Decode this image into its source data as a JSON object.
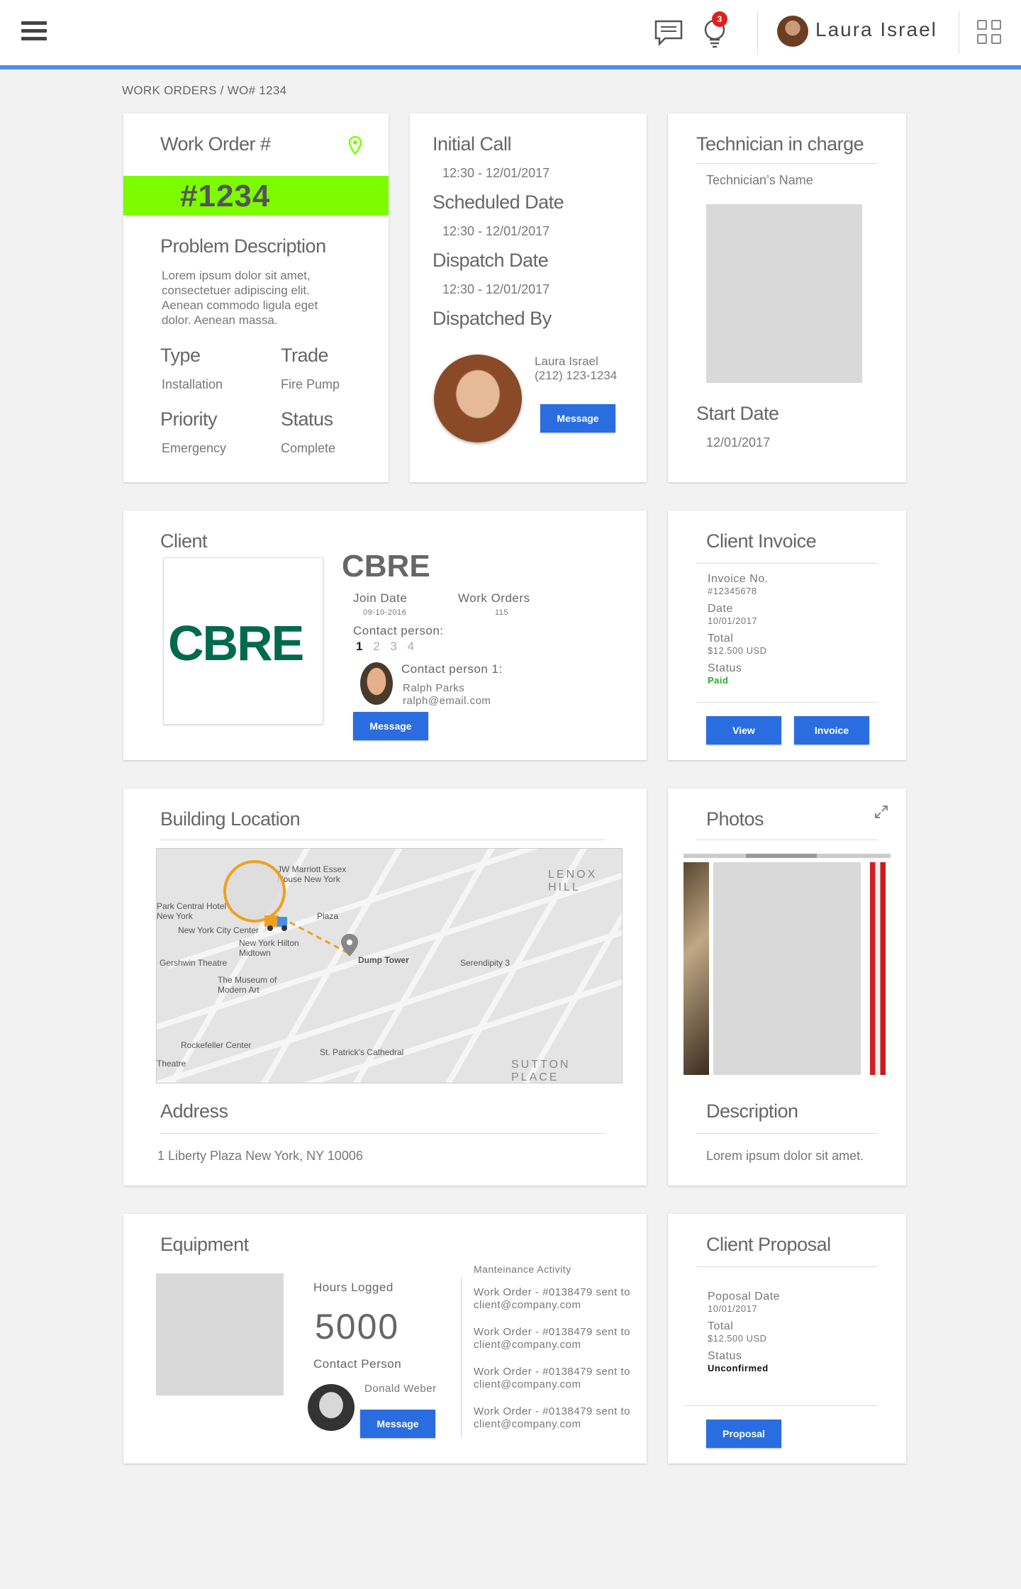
{
  "header": {
    "user_name": "Laura Israel",
    "notification_count": "3"
  },
  "breadcrumb": "WORK ORDERS / WO# 1234",
  "work_order": {
    "title": "Work Order #",
    "number": "#1234",
    "problem_title": "Problem Description",
    "problem_text": "Lorem ipsum dolor sit amet, consectetuer adipiscing elit. Aenean commodo ligula eget dolor. Aenean massa.",
    "type_label": "Type",
    "type_value": "Installation",
    "trade_label": "Trade",
    "trade_value": "Fire Pump",
    "priority_label": "Priority",
    "priority_value": "Emergency",
    "status_label": "Status",
    "status_value": "Complete",
    "accent": "#7dfc00"
  },
  "dates": {
    "initial_call_label": "Initial Call",
    "initial_call_value": "12:30 - 12/01/2017",
    "scheduled_label": "Scheduled Date",
    "scheduled_value": "12:30 - 12/01/2017",
    "dispatch_label": "Dispatch Date",
    "dispatch_value": "12:30 - 12/01/2017",
    "dispatched_by_label": "Dispatched By",
    "dispatcher_name": "Laura Israel",
    "dispatcher_phone": "(212) 123-1234",
    "message_button": "Message"
  },
  "technician": {
    "title": "Technician in charge",
    "name_label": "Technician’s Name",
    "start_label": "Start Date",
    "start_value": "12/01/2017"
  },
  "client": {
    "title": "Client",
    "logo_text": "CBRE",
    "name": "CBRE",
    "join_label": "Join Date",
    "join_value": "09-10-2016",
    "wo_label": "Work Orders",
    "wo_value": "115",
    "contact_label": "Contact person:",
    "pages": [
      "1",
      "2",
      "3",
      "4"
    ],
    "contact1_label": "Contact person 1:",
    "contact1_name": "Ralph Parks",
    "contact1_email": "ralph@email.com",
    "message_button": "Message"
  },
  "invoice": {
    "title": "Client Invoice",
    "no_label": "Invoice No.",
    "no_value": "#12345678",
    "date_label": "Date",
    "date_value": "10/01/2017",
    "total_label": "Total",
    "total_value": "$12.500 USD",
    "status_label": "Status",
    "status_value": "Paid",
    "view_button": "View",
    "invoice_button": "Invoice"
  },
  "location": {
    "title": "Building Location",
    "address_title": "Address",
    "address": "1 Liberty Plaza New York, NY 10006",
    "map_labels": {
      "marriott": "JW Marriott Essex House New York",
      "lenox": "LENOX HILL",
      "park_central": "Park Central Hotel New York",
      "nycc": "New York City Center",
      "hilton": "New York Hilton Midtown",
      "gershwin": "Gershwin Theatre",
      "moma": "The Museum of Modern Art",
      "dump": "Dump Tower",
      "serendipity": "Serendipity 3",
      "rock": "Rockefeller Center",
      "stpat": "St. Patrick's Cathedral",
      "sutton": "SUTTON PLACE",
      "plaza": "Plaza",
      "theatre": "Theatre"
    }
  },
  "photos": {
    "title": "Photos",
    "desc_title": "Description",
    "desc_text": "Lorem ipsum dolor sit amet."
  },
  "equipment": {
    "title": "Equipment",
    "hours_label": "Hours Logged",
    "hours_value": "5000",
    "contact_label": "Contact Person",
    "contact_name": "Donald Weber",
    "message_button": "Message",
    "activity_title": "Manteinance Activity",
    "activity": [
      "Work Order - #0138479 sent to client@company.com",
      "Work Order - #0138479 sent to client@company.com",
      "Work Order - #0138479 sent to client@company.com",
      "Work Order - #0138479 sent to client@company.com"
    ]
  },
  "proposal": {
    "title": "Client Proposal",
    "date_label": "Poposal Date",
    "date_value": "10/01/2017",
    "total_label": "Total",
    "total_value": "$12.500 USD",
    "status_label": "Status",
    "status_value": "Unconfirmed",
    "button": "Proposal"
  }
}
